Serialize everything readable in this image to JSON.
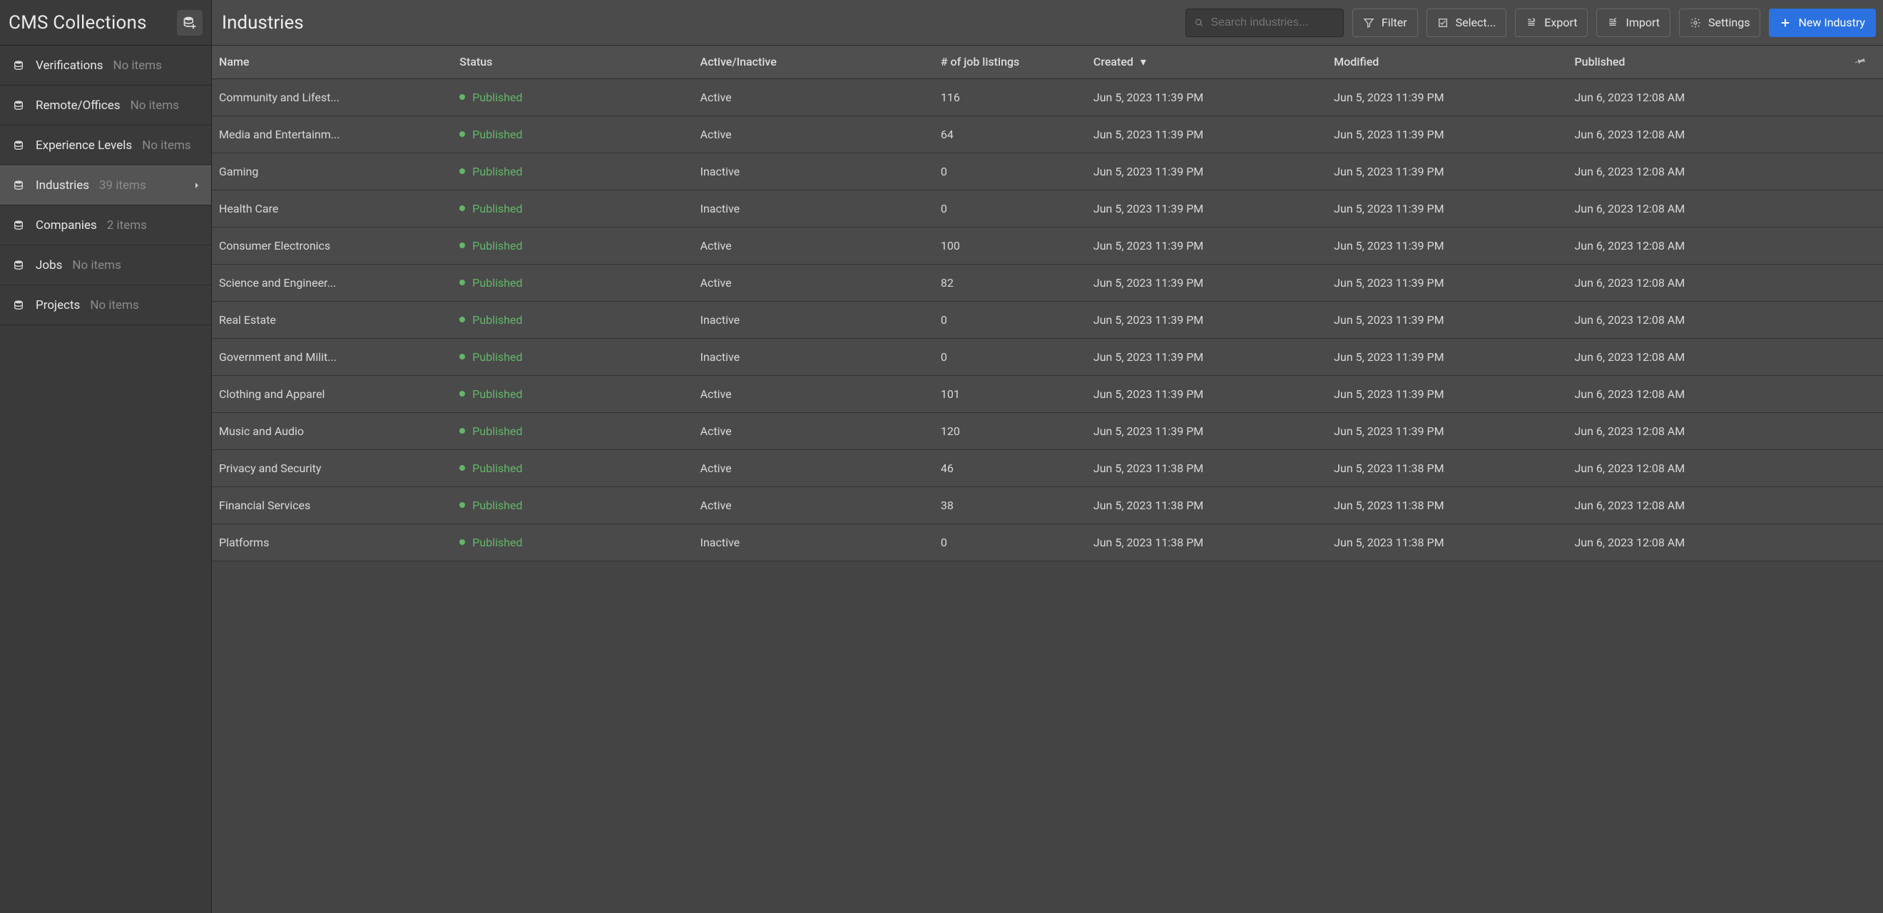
{
  "sidebar": {
    "title": "CMS Collections",
    "collections": [
      {
        "label": "Verifications",
        "count": "No items",
        "active": false
      },
      {
        "label": "Remote/Offices",
        "count": "No items",
        "active": false
      },
      {
        "label": "Experience Levels",
        "count": "No items",
        "active": false
      },
      {
        "label": "Industries",
        "count": "39 items",
        "active": true
      },
      {
        "label": "Companies",
        "count": "2 items",
        "active": false
      },
      {
        "label": "Jobs",
        "count": "No items",
        "active": false
      },
      {
        "label": "Projects",
        "count": "No items",
        "active": false
      }
    ]
  },
  "topbar": {
    "title": "Industries",
    "search_placeholder": "Search industries...",
    "filter_label": "Filter",
    "select_label": "Select...",
    "export_label": "Export",
    "import_label": "Import",
    "settings_label": "Settings",
    "new_label": "New Industry"
  },
  "table": {
    "columns": {
      "name": "Name",
      "status": "Status",
      "active": "Active/Inactive",
      "jobs": "# of job listings",
      "created": "Created",
      "modified": "Modified",
      "published": "Published"
    },
    "rows": [
      {
        "name": "Community and Lifest...",
        "status": "Published",
        "active": "Active",
        "jobs": "116",
        "created": "Jun 5, 2023 11:39 PM",
        "modified": "Jun 5, 2023 11:39 PM",
        "published": "Jun 6, 2023 12:08 AM"
      },
      {
        "name": "Media and Entertainm...",
        "status": "Published",
        "active": "Active",
        "jobs": "64",
        "created": "Jun 5, 2023 11:39 PM",
        "modified": "Jun 5, 2023 11:39 PM",
        "published": "Jun 6, 2023 12:08 AM"
      },
      {
        "name": "Gaming",
        "status": "Published",
        "active": "Inactive",
        "jobs": "0",
        "created": "Jun 5, 2023 11:39 PM",
        "modified": "Jun 5, 2023 11:39 PM",
        "published": "Jun 6, 2023 12:08 AM"
      },
      {
        "name": "Health Care",
        "status": "Published",
        "active": "Inactive",
        "jobs": "0",
        "created": "Jun 5, 2023 11:39 PM",
        "modified": "Jun 5, 2023 11:39 PM",
        "published": "Jun 6, 2023 12:08 AM"
      },
      {
        "name": "Consumer Electronics",
        "status": "Published",
        "active": "Active",
        "jobs": "100",
        "created": "Jun 5, 2023 11:39 PM",
        "modified": "Jun 5, 2023 11:39 PM",
        "published": "Jun 6, 2023 12:08 AM"
      },
      {
        "name": "Science and Engineer...",
        "status": "Published",
        "active": "Active",
        "jobs": "82",
        "created": "Jun 5, 2023 11:39 PM",
        "modified": "Jun 5, 2023 11:39 PM",
        "published": "Jun 6, 2023 12:08 AM"
      },
      {
        "name": "Real Estate",
        "status": "Published",
        "active": "Inactive",
        "jobs": "0",
        "created": "Jun 5, 2023 11:39 PM",
        "modified": "Jun 5, 2023 11:39 PM",
        "published": "Jun 6, 2023 12:08 AM"
      },
      {
        "name": "Government and Milit...",
        "status": "Published",
        "active": "Inactive",
        "jobs": "0",
        "created": "Jun 5, 2023 11:39 PM",
        "modified": "Jun 5, 2023 11:39 PM",
        "published": "Jun 6, 2023 12:08 AM"
      },
      {
        "name": "Clothing and Apparel",
        "status": "Published",
        "active": "Active",
        "jobs": "101",
        "created": "Jun 5, 2023 11:39 PM",
        "modified": "Jun 5, 2023 11:39 PM",
        "published": "Jun 6, 2023 12:08 AM"
      },
      {
        "name": "Music and Audio",
        "status": "Published",
        "active": "Active",
        "jobs": "120",
        "created": "Jun 5, 2023 11:39 PM",
        "modified": "Jun 5, 2023 11:39 PM",
        "published": "Jun 6, 2023 12:08 AM"
      },
      {
        "name": "Privacy and Security",
        "status": "Published",
        "active": "Active",
        "jobs": "46",
        "created": "Jun 5, 2023 11:38 PM",
        "modified": "Jun 5, 2023 11:38 PM",
        "published": "Jun 6, 2023 12:08 AM"
      },
      {
        "name": "Financial Services",
        "status": "Published",
        "active": "Active",
        "jobs": "38",
        "created": "Jun 5, 2023 11:38 PM",
        "modified": "Jun 5, 2023 11:38 PM",
        "published": "Jun 6, 2023 12:08 AM"
      },
      {
        "name": "Platforms",
        "status": "Published",
        "active": "Inactive",
        "jobs": "0",
        "created": "Jun 5, 2023 11:38 PM",
        "modified": "Jun 5, 2023 11:38 PM",
        "published": "Jun 6, 2023 12:08 AM"
      }
    ]
  }
}
